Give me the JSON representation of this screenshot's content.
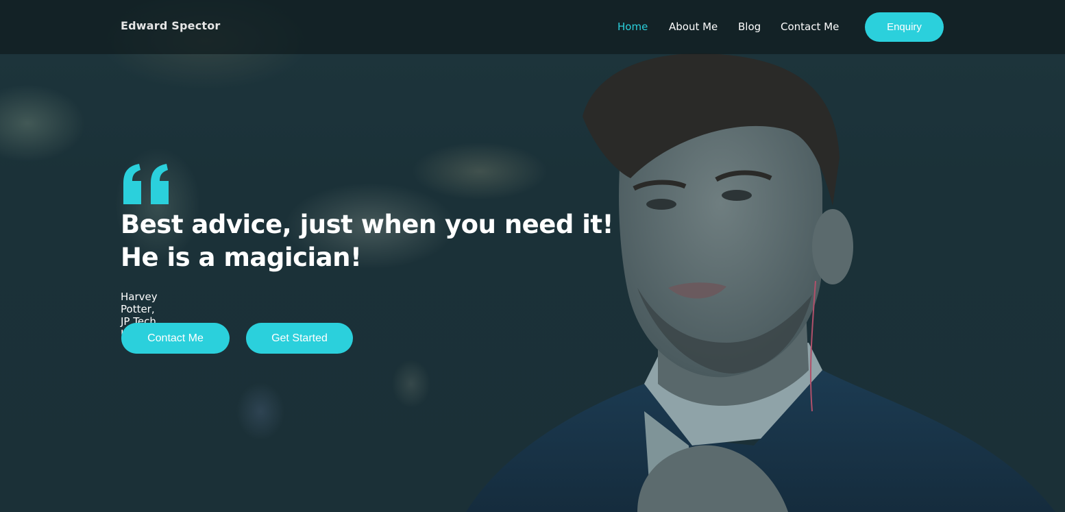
{
  "brand": {
    "name": "Edward Spector"
  },
  "nav": {
    "items": [
      {
        "label": "Home",
        "active": true
      },
      {
        "label": "About Me",
        "active": false
      },
      {
        "label": "Blog",
        "active": false
      },
      {
        "label": "Contact Me",
        "active": false
      }
    ],
    "enquiry_label": "Enquiry"
  },
  "hero": {
    "quote_icon": "quote-mark-icon",
    "headline_line1": "Best advice, just when you need it!",
    "headline_line2": "He is a magician!",
    "attribution": "Harvey Potter, JP Tech Inc",
    "buttons": {
      "contact": "Contact Me",
      "get_started": "Get Started"
    }
  },
  "colors": {
    "accent": "#2bd0dc",
    "navbar": "#0f1c1e",
    "text": "#ffffff"
  }
}
